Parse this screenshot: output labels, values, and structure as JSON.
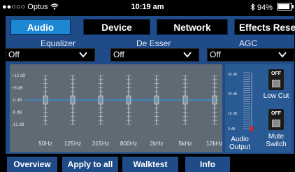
{
  "status_bar": {
    "carrier": "Optus",
    "signal_dots": "●●○○○",
    "time": "10:19 am",
    "battery": "94%"
  },
  "tabs": [
    {
      "label": "Audio",
      "active": true
    },
    {
      "label": "Device",
      "active": false
    },
    {
      "label": "Network",
      "active": false
    },
    {
      "label": "Effects Reset",
      "active": false
    }
  ],
  "controls": {
    "equalizer": {
      "label": "Equalizer",
      "value": "Off"
    },
    "de_esser": {
      "label": "De Esser",
      "value": "Off"
    },
    "agc": {
      "label": "AGC",
      "value": "Off"
    }
  },
  "eq": {
    "db_labels": [
      "+12 dB",
      "+6 dB",
      "-0 dB",
      "-6 dB",
      "-12 dB"
    ],
    "bands": [
      "50Hz",
      "125Hz",
      "315Hz",
      "800Hz",
      "2kHz",
      "5kHz",
      "12kHz"
    ],
    "gains_db": [
      0,
      0,
      0,
      0,
      0,
      0,
      0
    ]
  },
  "output": {
    "meter_labels": [
      "60 dB",
      "30 dB",
      "10 dB",
      "0 dB"
    ],
    "label": "Audio Output",
    "low_cut": {
      "label": "Low Cut",
      "state": "OFF"
    },
    "mute": {
      "label": "Mute Switch",
      "state": "OFF"
    }
  },
  "bottom_bar": [
    "Overview",
    "Apply to all",
    "Walktest",
    "Info"
  ],
  "colors": {
    "panel": "#1f4c89",
    "active_tab": "#1d87d4",
    "eq_bg": "#5f6a74",
    "eq_line": "#1fa3ff",
    "meter_red": "#e22020"
  }
}
